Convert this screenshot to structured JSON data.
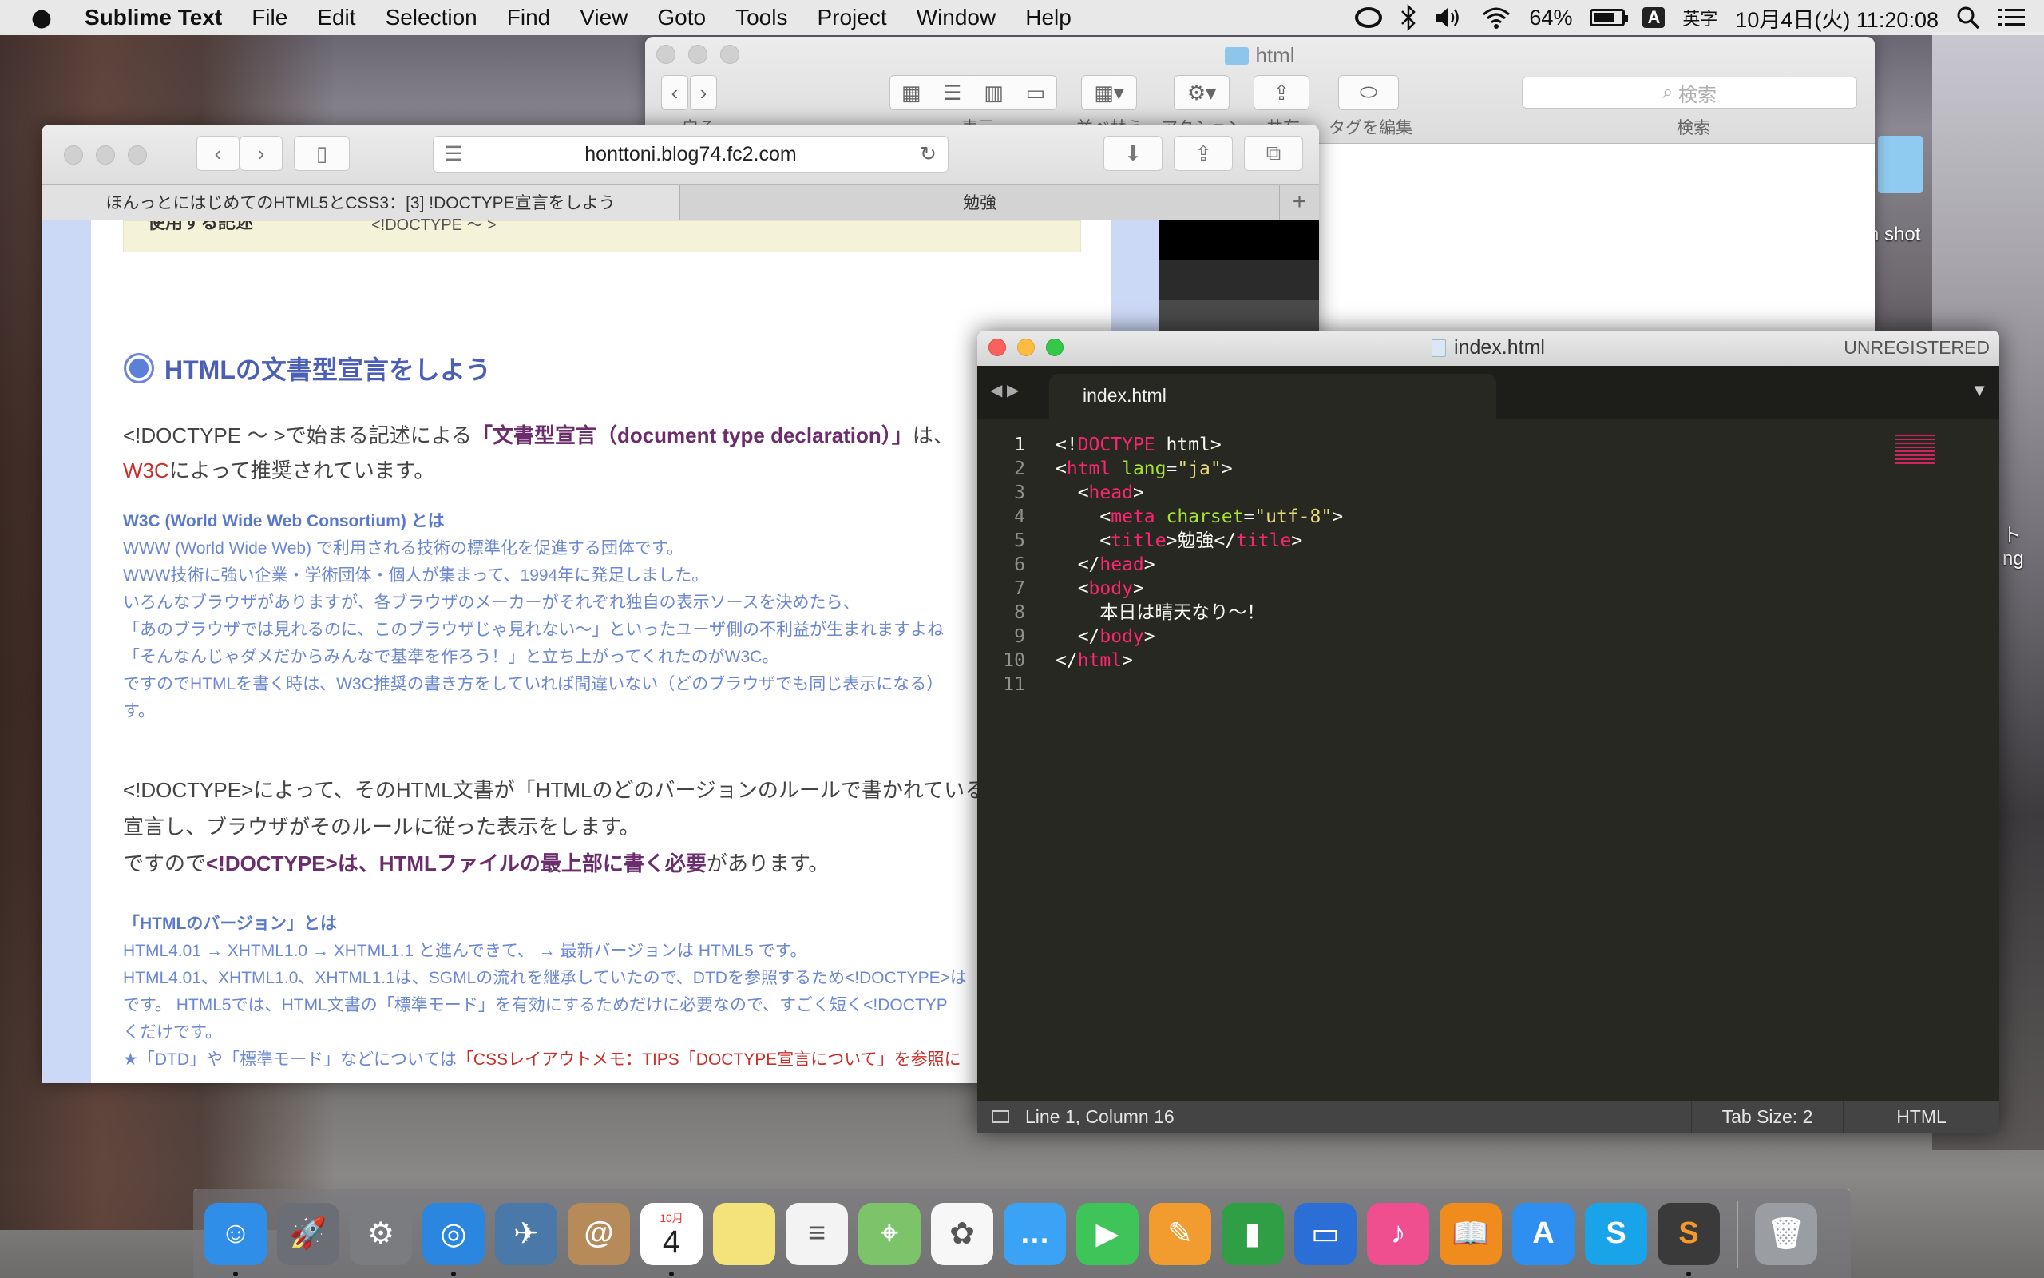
{
  "menubar": {
    "app_name": "Sublime Text",
    "items": [
      "File",
      "Edit",
      "Selection",
      "Find",
      "View",
      "Goto",
      "Tools",
      "Project",
      "Window",
      "Help"
    ],
    "battery": "64%",
    "ime_badge": "A",
    "ime_label": "英字",
    "clock": "10月4日(火)  11:20:08"
  },
  "finder": {
    "title": "html",
    "toolbar_labels": [
      "戻る",
      "表示",
      "並べ替え",
      "アクション",
      "共有",
      "タグを編集",
      "検索"
    ],
    "search_placeholder": "検索"
  },
  "desktop": {
    "labels": [
      "n shot",
      "ト",
      "ng"
    ]
  },
  "safari": {
    "url": "honttoni.blog74.fc2.com",
    "tabs": [
      "ほんっとにはじめてのHTML5とCSS3：[3] !DOCTYPE宣言をしよう",
      "勉強"
    ],
    "page": {
      "table_cut": "使用する記述",
      "table_cut_value": "<!DOCTYPE ～ >",
      "heading": "HTMLの文書型宣言をしよう",
      "p1_a": "<!DOCTYPE ～ >で始まる記述による",
      "p1_b": "「文書型宣言（document type declaration）」",
      "p1_c": "は、",
      "p1_w3c": "W3C",
      "p1_d": "によって推奨されています。",
      "note1_title": "W3C (World Wide Web Consortium) とは",
      "note1_lines": [
        "WWW (World Wide Web) で利用される技術の標準化を促進する団体です。",
        "WWW技術に強い企業・学術団体・個人が集まって、1994年に発足しました。",
        "いろんなブラウザがありますが、各ブラウザのメーカーがそれぞれ独自の表示ソースを決めたら、",
        "「あのブラウザでは見れるのに、このブラウザじゃ見れない～」といったユーザ側の不利益が生まれますよね",
        "「そんなんじゃダメだからみんなで基準を作ろう！」と立ち上がってくれたのがW3C。",
        "ですのでHTMLを書く時は、W3C推奨の書き方をしていれば間違いない（どのブラウザでも同じ表示になる）",
        "す。"
      ],
      "p2_a": "<!DOCTYPE>によって、そのHTML文書が「HTMLのどのバージョンのルールで書かれているの",
      "p2_b": "宣言し、ブラウザがそのルールに従った表示をします。",
      "p2_c": "ですので",
      "p2_d": "<!DOCTYPE>は、HTMLファイルの最上部に書く必要",
      "p2_e": "があります。",
      "note2_title": "「HTMLのバージョン」とは",
      "note2_lines": [
        "HTML4.01 → XHTML1.0 → XHTML1.1 と進んできて、 → 最新バージョンは HTML5 です。",
        "HTML4.01、XHTML1.0、XHTML1.1は、SGMLの流れを継承していたので、DTDを参照するため<!DOCTYPE>は",
        "です。 HTML5では、HTML文書の「標準モード」を有効にするためだけに必要なので、すごく短く<!DOCTYP",
        "くだけです。"
      ],
      "note2_star_a": "★「DTD」や「標準モード」などについては",
      "note2_star_b": "「CSSレイアウトメモ：TIPS「DOCTYPE宣言について」を参照に"
    }
  },
  "sublime": {
    "title": "index.html",
    "unregistered": "UNREGISTERED",
    "tab": "index.html",
    "line_numbers": [
      "1",
      "2",
      "3",
      "4",
      "5",
      "6",
      "7",
      "8",
      "9",
      "10",
      "11"
    ],
    "code": {
      "l1_a": "<!",
      "l1_b": "DOCTYPE",
      "l1_c": " html>",
      "l2_a": "<",
      "l2_b": "html",
      "l2_c": "lang",
      "l2_d": "=",
      "l2_e": "\"ja\"",
      "l2_f": ">",
      "l3": "head",
      "l4_a": "meta",
      "l4_b": "charset",
      "l4_c": "\"utf-8\"",
      "l5_a": "title",
      "l5_b": "勉強",
      "l6": "head",
      "l7": "body",
      "l8": "本日は晴天なり～！",
      "l9": "body",
      "l10": "html"
    },
    "status": {
      "position": "Line 1, Column 16",
      "tab_size": "Tab Size: 2",
      "syntax": "HTML"
    }
  },
  "dock": {
    "items": [
      {
        "name": "finder",
        "color": "#2f8ee8"
      },
      {
        "name": "launchpad",
        "color": "#6b6e74"
      },
      {
        "name": "system-preferences",
        "color": "#7b7c80"
      },
      {
        "name": "safari",
        "color": "#2b86e0"
      },
      {
        "name": "preview",
        "color": "#4a78a8"
      },
      {
        "name": "contacts",
        "color": "#b78a5a"
      },
      {
        "name": "calendar",
        "color": "#ffffff"
      },
      {
        "name": "notes",
        "color": "#f3e37a"
      },
      {
        "name": "reminders",
        "color": "#f3f3f3"
      },
      {
        "name": "maps",
        "color": "#7cc36a"
      },
      {
        "name": "photos",
        "color": "#f7f7f7"
      },
      {
        "name": "messages",
        "color": "#3aa3f5"
      },
      {
        "name": "facetime",
        "color": "#3fc45a"
      },
      {
        "name": "pages",
        "color": "#f29b2f"
      },
      {
        "name": "numbers",
        "color": "#2f9e44"
      },
      {
        "name": "keynote",
        "color": "#2b6fd6"
      },
      {
        "name": "itunes",
        "color": "#ef4f8e"
      },
      {
        "name": "ibooks",
        "color": "#f08b1e"
      },
      {
        "name": "app-store",
        "color": "#2e8ff0"
      },
      {
        "name": "skype",
        "color": "#19a3e8"
      },
      {
        "name": "sublime-text",
        "color": "#3a3a3a"
      },
      {
        "name": "trash",
        "color": "#9a9da2"
      }
    ],
    "calendar_month": "10月",
    "calendar_day": "4"
  }
}
